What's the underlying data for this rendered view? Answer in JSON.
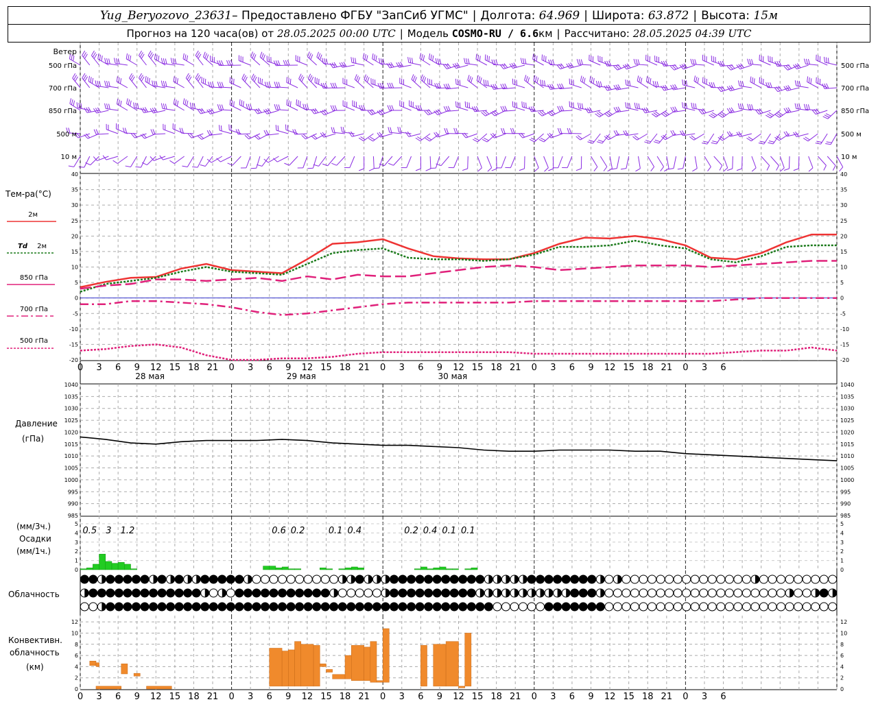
{
  "header": {
    "station": "Yug_Beryozovo_23631",
    "provided": " – Предоставлено ФГБУ \"ЗапСиб УГМС\"",
    "lon_label": "Долгота:",
    "lon": "64.969",
    "lat_label": "Широта:",
    "lat": "63.872",
    "alt_label": "Высота:",
    "alt": "15м",
    "forecast_label": "Прогноз на 120 часа(ов) от",
    "forecast_start": "28.05.2025 00:00 UTC",
    "model_label": "Модель",
    "model": "COSMO-RU / 6.6",
    "model_unit": "км",
    "calc_label": "Рассчитано:",
    "calc_time": "28.05.2025 04:39 UTC"
  },
  "labels": {
    "wind": "Ветер",
    "temp": "Тем-ра(°С)",
    "t2m": "2м",
    "td": "Td",
    "td2m": "2м",
    "p850": "850 гПа",
    "p700": "700 гПа",
    "p500": "500 гПа",
    "pressure": "Давление",
    "pressure_unit": "(гПа)",
    "precip_unit3": "(мм/3ч.)",
    "precip": "Осадки",
    "precip_unit1": "(мм/1ч.)",
    "cloud": "Облачность",
    "conv1": "Конвективн.",
    "conv2": "облачность",
    "conv3": "(км)"
  },
  "wind_levels": [
    "500 гПа",
    "700 гПа",
    "850 гПа",
    "500 м",
    "10 м"
  ],
  "wind_levels_right": [
    "500 гПа",
    "700 гПа",
    "850 гПа",
    "500 м",
    "10 м"
  ],
  "day_labels": [
    "28 мая",
    "29 мая",
    "30 мая"
  ],
  "colors": {
    "wind": "#8a2be2",
    "t2m": "#ee3333",
    "td": "#1a7a1a",
    "p850": "#e0207a",
    "p700": "#e0207a",
    "p500": "#e0207a",
    "zero_line": "#3333cc",
    "pressure": "#000000",
    "precip": "#22cc22",
    "conv": "#f08a2c"
  },
  "chart_data": [
    {
      "type": "line",
      "name": "temperature",
      "x_hours": [
        0,
        3,
        6,
        9,
        12,
        15,
        18,
        21,
        24,
        27,
        30,
        33,
        36,
        39,
        42,
        45,
        48,
        51,
        54,
        57,
        60,
        63,
        66,
        69,
        72,
        75,
        78,
        81,
        84,
        87,
        90,
        93,
        96,
        99,
        102,
        105,
        108,
        111,
        114,
        117,
        120
      ],
      "x_ticks": [
        "0",
        "3",
        "6",
        "9",
        "12",
        "15",
        "18",
        "21",
        "0",
        "3",
        "6",
        "9",
        "12",
        "15",
        "18",
        "21",
        "0",
        "3",
        "6",
        "9",
        "12",
        "15",
        "18",
        "21",
        "0",
        "3",
        "6",
        "9",
        "12",
        "15",
        "18",
        "21",
        "0",
        "3",
        "6"
      ],
      "ylim": [
        -20,
        40
      ],
      "yticks": [
        40,
        35,
        30,
        25,
        20,
        15,
        10,
        5,
        0,
        -5,
        -10,
        -15,
        -20
      ],
      "series": [
        {
          "name": "2м",
          "values": [
            3.5,
            5.2,
            6.5,
            6.8,
            9.5,
            11,
            9,
            8.5,
            8,
            12.5,
            17.5,
            18,
            19,
            16,
            13.5,
            12.8,
            12.5,
            12.5,
            14.5,
            17.5,
            19.5,
            19.2,
            20,
            19,
            17,
            13,
            12.5,
            14.5,
            18,
            20.5,
            20.5
          ]
        },
        {
          "name": "Td 2м",
          "values": [
            2,
            4.5,
            5.5,
            6.5,
            8.5,
            10,
            8.5,
            8,
            7.5,
            11,
            14.5,
            15.5,
            16,
            13,
            12.5,
            12.5,
            12,
            12.5,
            14,
            16.5,
            16.5,
            17,
            18.5,
            17,
            16,
            12.5,
            11.5,
            13.5,
            16.5,
            17,
            17
          ]
        },
        {
          "name": "850 гПа",
          "values": [
            3,
            4,
            4.5,
            6,
            6,
            5.5,
            6,
            6.5,
            5.5,
            7,
            6,
            7.5,
            7,
            7,
            8,
            9,
            10,
            10.5,
            10,
            9,
            9.5,
            10,
            10.5,
            10.5,
            10.5,
            10,
            10.5,
            11,
            11.5,
            12,
            12
          ]
        },
        {
          "name": "700 гПа",
          "values": [
            -2,
            -2,
            -1,
            -1,
            -1.5,
            -2,
            -3,
            -4.5,
            -5.5,
            -5,
            -4,
            -3,
            -2,
            -1.5,
            -1.5,
            -1.5,
            -1.5,
            -1.5,
            -1,
            -1,
            -1,
            -1,
            -1,
            -1,
            -1,
            -1,
            -0.5,
            0,
            0,
            0,
            0
          ]
        },
        {
          "name": "500 гПа",
          "values": [
            -17,
            -16.5,
            -15.5,
            -15,
            -16,
            -18.5,
            -20,
            -21,
            -19.5,
            -19.5,
            -19,
            -18,
            -17.5,
            -17.5,
            -17.5,
            -17.5,
            -17.5,
            -17.5,
            -18,
            -18,
            -18,
            -18,
            -18,
            -18,
            -18,
            -18,
            -17.5,
            -17,
            -17,
            -16,
            -17
          ]
        }
      ]
    },
    {
      "type": "line",
      "name": "pressure",
      "ylim": [
        985,
        1040
      ],
      "yticks": [
        1040,
        1035,
        1030,
        1025,
        1020,
        1015,
        1010,
        1005,
        1000,
        995,
        990,
        985
      ],
      "series": [
        {
          "name": "Давление",
          "values": [
            1018,
            1017,
            1015.5,
            1015,
            1016,
            1016.5,
            1016.5,
            1016.5,
            1017,
            1016.5,
            1015.5,
            1015,
            1014.5,
            1014.5,
            1014,
            1013.5,
            1012.5,
            1012,
            1012,
            1012.5,
            1012.5,
            1012.5,
            1012,
            1012,
            1011,
            1010.5,
            1010,
            1009.5,
            1009,
            1008.5,
            1008
          ]
        }
      ]
    },
    {
      "type": "bar",
      "name": "precipitation",
      "ylim": [
        0,
        5
      ],
      "yticks": [
        5,
        4,
        3,
        2,
        1,
        0
      ],
      "annotations": [
        {
          "hour": 1.5,
          "text": "0.5"
        },
        {
          "hour": 4.5,
          "text": "3"
        },
        {
          "hour": 7.5,
          "text": "1.2"
        },
        {
          "hour": 31.5,
          "text": "0.6"
        },
        {
          "hour": 34.5,
          "text": "0.2"
        },
        {
          "hour": 40.5,
          "text": "0.1"
        },
        {
          "hour": 43.5,
          "text": "0.4"
        },
        {
          "hour": 52.5,
          "text": "0.2"
        },
        {
          "hour": 55.5,
          "text": "0.4"
        },
        {
          "hour": 58.5,
          "text": "0.1"
        },
        {
          "hour": 61.5,
          "text": "0.1"
        }
      ],
      "hourly": [
        0.1,
        0.2,
        0.6,
        1.7,
        0.9,
        0.7,
        0.8,
        0.6,
        0.1,
        0,
        0,
        0,
        0,
        0,
        0,
        0,
        0,
        0,
        0,
        0,
        0,
        0,
        0,
        0,
        0,
        0,
        0,
        0,
        0,
        0.4,
        0.4,
        0.2,
        0.3,
        0.1,
        0.1,
        0,
        0,
        0,
        0.2,
        0.1,
        0,
        0.1,
        0.2,
        0.3,
        0.2,
        0,
        0,
        0,
        0,
        0,
        0,
        0,
        0,
        0.1,
        0.3,
        0.1,
        0.2,
        0.3,
        0.1,
        0.1,
        0,
        0.1,
        0.2,
        0,
        0,
        0,
        0,
        0,
        0,
        0,
        0,
        0,
        0,
        0,
        0,
        0,
        0,
        0,
        0,
        0,
        0,
        0,
        0,
        0,
        0,
        0,
        0,
        0,
        0,
        0,
        0,
        0,
        0,
        0,
        0,
        0,
        0,
        0,
        0,
        0,
        0,
        0,
        0,
        0,
        0,
        0,
        0,
        0,
        0,
        0,
        0,
        0,
        0,
        0,
        0,
        0,
        0,
        0,
        0,
        0,
        0
      ]
    },
    {
      "type": "bar",
      "name": "convective cloud",
      "ylim": [
        0,
        13
      ],
      "yticks": [
        12,
        10,
        8,
        6,
        4,
        2,
        0
      ],
      "bars": [
        {
          "h0": 1.5,
          "h1": 2.5,
          "base": 4.2,
          "top": 5
        },
        {
          "h0": 2.5,
          "h1": 3,
          "base": 4,
          "top": 4.7
        },
        {
          "h0": 6.5,
          "h1": 7.5,
          "base": 2.7,
          "top": 4.5
        },
        {
          "h0": 8.5,
          "h1": 9.5,
          "base": 2.3,
          "top": 2.8
        },
        {
          "h0": 2.5,
          "h1": 6.5,
          "base": 0,
          "top": 0.5
        },
        {
          "h0": 10.5,
          "h1": 14.5,
          "base": 0,
          "top": 0.5
        },
        {
          "h0": 30,
          "h1": 32,
          "base": 0.5,
          "top": 7.3
        },
        {
          "h0": 32,
          "h1": 33,
          "base": 0.5,
          "top": 6.8
        },
        {
          "h0": 33,
          "h1": 34,
          "base": 0.5,
          "top": 7
        },
        {
          "h0": 34,
          "h1": 35,
          "base": 0.5,
          "top": 8.5
        },
        {
          "h0": 35,
          "h1": 37,
          "base": 0.5,
          "top": 8
        },
        {
          "h0": 37,
          "h1": 38,
          "base": 0.5,
          "top": 7.8
        },
        {
          "h0": 38,
          "h1": 39,
          "base": 4,
          "top": 4.5
        },
        {
          "h0": 39,
          "h1": 40,
          "base": 3,
          "top": 3.5
        },
        {
          "h0": 40,
          "h1": 42,
          "base": 1.8,
          "top": 2.6
        },
        {
          "h0": 42,
          "h1": 43,
          "base": 1.8,
          "top": 6
        },
        {
          "h0": 43,
          "h1": 45,
          "base": 1.5,
          "top": 7.8
        },
        {
          "h0": 45,
          "h1": 46,
          "base": 1.5,
          "top": 7.5
        },
        {
          "h0": 46,
          "h1": 47,
          "base": 1.2,
          "top": 8.5
        },
        {
          "h0": 47,
          "h1": 48,
          "base": 1.2,
          "top": 1.5
        },
        {
          "h0": 48,
          "h1": 49,
          "base": 1.2,
          "top": 10.8
        },
        {
          "h0": 54,
          "h1": 55,
          "base": 0.5,
          "top": 7.8
        },
        {
          "h0": 56,
          "h1": 58,
          "base": 0.5,
          "top": 8
        },
        {
          "h0": 58,
          "h1": 60,
          "base": 0.5,
          "top": 8.5
        },
        {
          "h0": 60,
          "h1": 61,
          "base": 0.2,
          "top": 0.5
        },
        {
          "h0": 61,
          "h1": 62,
          "base": 0.5,
          "top": 10
        }
      ]
    }
  ],
  "cloud_rows": [
    "FFHFFFFFHFHFHHFFFFFHOOOOOOOOOOHHFHHHFFFFFFFFFFFHHHHHFFFFFFFFHOHOOOOOOOOOOOOOOOHOOOOOOOOO",
    "HFFFFFFFFFFFFFHOHOFFFFFFFFFFFHOOOOOHFFFFFFFFFFHHHHHHHHHHHFFFHOOOOOOOOOOOOOOOOOOOOOHOOHFH",
    "OOHFFFFFFFFFFFFFFFFFFFFFFFFFFFFFFFFFFFFFFFFFFFFFOOOOOOFFFFFFFOOOOOOOOOOOOOOOOOOOOOOOOOOO"
  ]
}
